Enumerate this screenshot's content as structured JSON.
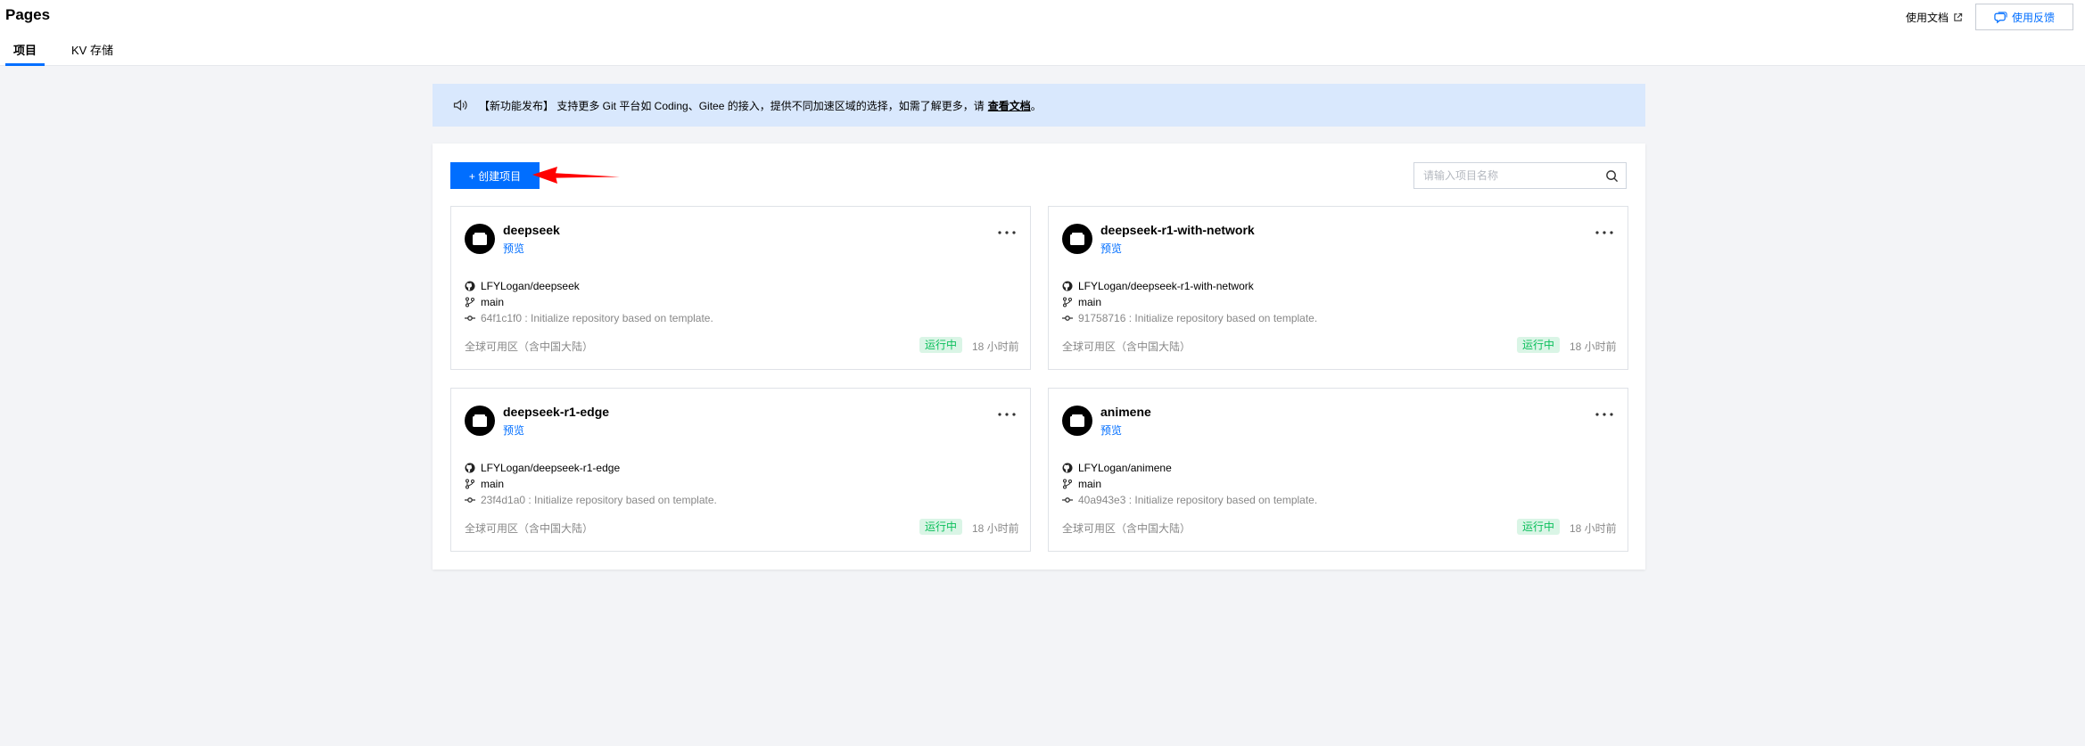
{
  "header": {
    "title": "Pages",
    "tabs": [
      {
        "label": "项目",
        "active": true
      },
      {
        "label": "KV 存储",
        "active": false
      }
    ],
    "doc_link": "使用文档",
    "feedback_button": "使用反馈"
  },
  "notice": {
    "text": "【新功能发布】 支持更多 Git 平台如 Coding、Gitee 的接入，提供不同加速区域的选择，如需了解更多，请",
    "link": "查看文档",
    "suffix": "。"
  },
  "toolbar": {
    "create_button": "+ 创建项目",
    "search_placeholder": "请输入项目名称"
  },
  "projects": [
    {
      "name": "deepseek",
      "preview": "预览",
      "repo": "LFYLogan/deepseek",
      "branch": "main",
      "commit": "64f1c1f0 : Initialize repository based on template.",
      "region": "全球可用区（含中国大陆）",
      "status": "运行中",
      "time": "18 小时前"
    },
    {
      "name": "deepseek-r1-with-network",
      "preview": "预览",
      "repo": "LFYLogan/deepseek-r1-with-network",
      "branch": "main",
      "commit": "91758716 : Initialize repository based on template.",
      "region": "全球可用区（含中国大陆）",
      "status": "运行中",
      "time": "18 小时前"
    },
    {
      "name": "deepseek-r1-edge",
      "preview": "预览",
      "repo": "LFYLogan/deepseek-r1-edge",
      "branch": "main",
      "commit": "23f4d1a0 : Initialize repository based on template.",
      "region": "全球可用区（含中国大陆）",
      "status": "运行中",
      "time": "18 小时前"
    },
    {
      "name": "animene",
      "preview": "预览",
      "repo": "LFYLogan/animene",
      "branch": "main",
      "commit": "40a943e3 : Initialize repository based on template.",
      "region": "全球可用区（含中国大陆）",
      "status": "运行中",
      "time": "18 小时前"
    }
  ],
  "colors": {
    "accent": "#006eff",
    "notice_bg": "#d9e8fd",
    "status_bg": "#daf5e6",
    "status_text": "#0abf5b",
    "arrow": "#ff0000"
  },
  "icons": {
    "notice": "speaker-icon",
    "search": "search-icon",
    "repo": "github-icon",
    "branch": "git-branch-icon",
    "commit": "git-commit-icon",
    "more": "more-dots-icon",
    "avatar": "folder-icon",
    "feedback": "chat-bubble-icon",
    "doc": "external-link-icon",
    "annotation": "red-arrow-icon"
  }
}
